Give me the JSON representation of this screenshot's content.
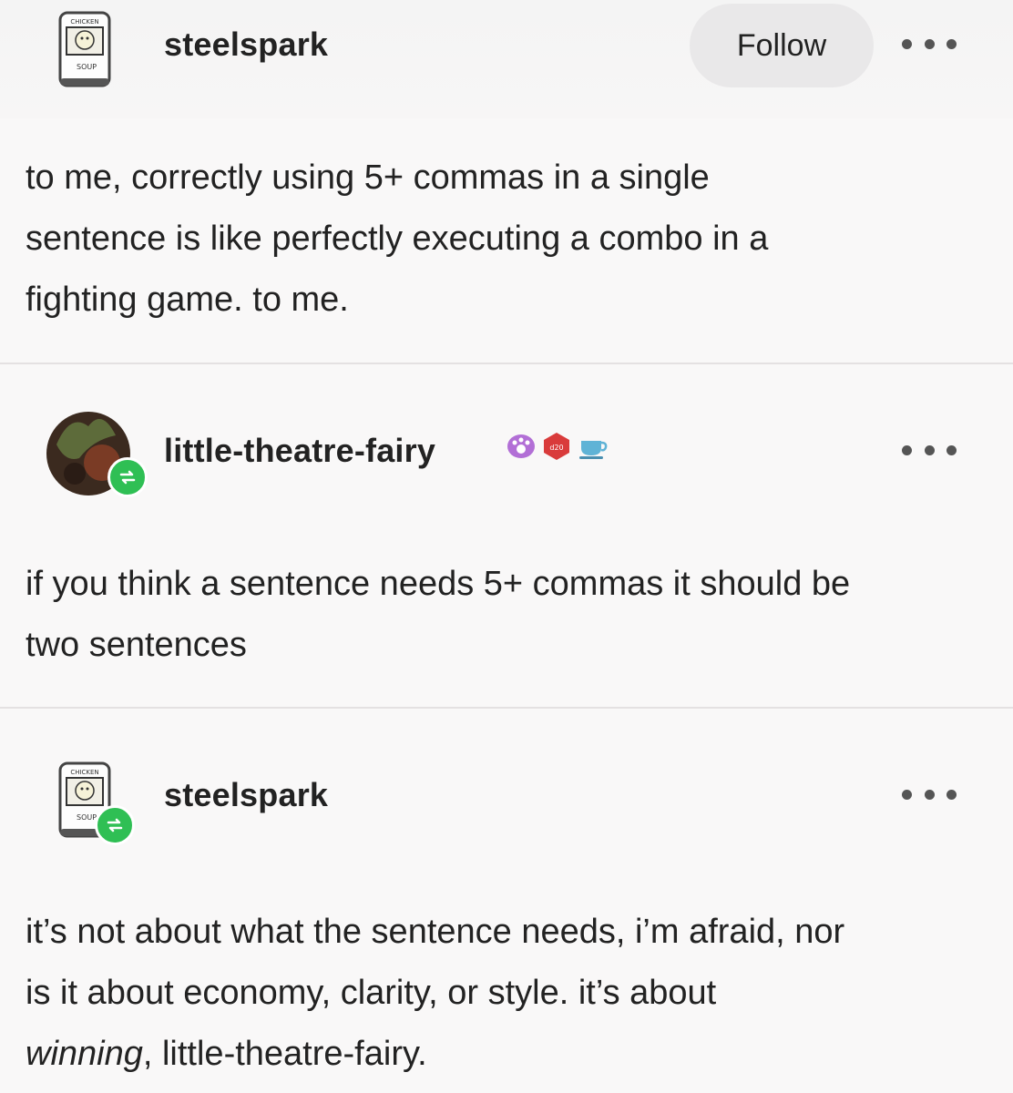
{
  "posts": [
    {
      "username": "steelspark",
      "follow_label": "Follow",
      "text_lines": [
        "to me, correctly using 5+ commas in a single",
        "sentence is like perfectly executing a combo in a",
        "fighting game. to me."
      ]
    },
    {
      "username": "little-theatre-fairy",
      "badge_icons": [
        "paw-badge-icon",
        "dice-badge-icon",
        "teacup-badge-icon"
      ],
      "text_lines": [
        "if you think a sentence needs 5+ commas it should be",
        "two sentences"
      ]
    },
    {
      "username": "steelspark",
      "text_lines": [
        "it’s not about what the sentence needs, i’m afraid, nor",
        "is it about economy, clarity, or style. it’s about"
      ],
      "last_line_italic": "winning",
      "last_line_rest": ", little-theatre-fairy."
    }
  ],
  "avatar_text": {
    "can_top": "CHICKEN",
    "can_bottom": "SOUP"
  },
  "colors": {
    "reblog_green": "#2fbf54",
    "follow_bg": "#e9e8e9"
  }
}
